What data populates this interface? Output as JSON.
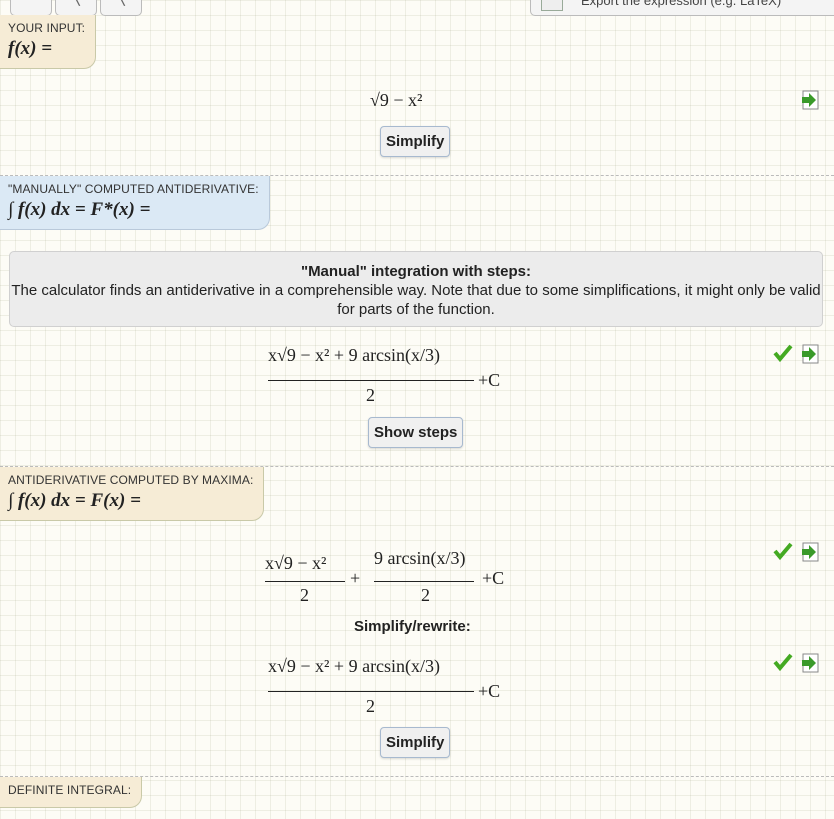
{
  "toolbar": {
    "export_label": "Export the expression (e.g. LaTeX)"
  },
  "input_section": {
    "caption": "YOUR INPUT:",
    "formula": "f(x) =",
    "expression": "√9 − x²",
    "simplify_label": "Simplify"
  },
  "manual_section": {
    "caption": "\"MANUALLY\" COMPUTED ANTIDERIVATIVE:",
    "formula": "∫ f(x) dx = F*(x) =",
    "info_title": "\"Manual\" integration with steps:",
    "info_text": "The calculator finds an antiderivative in a comprehensible way. Note that due to some simplifications, it might only be valid for parts of the function.",
    "result_numerator": "x√9 − x² + 9 arcsin(x/3)",
    "result_denominator": "2",
    "plus_c": "+C",
    "show_steps_label": "Show steps"
  },
  "maxima_section": {
    "caption": "ANTIDERIVATIVE COMPUTED BY MAXIMA:",
    "formula": "∫ f(x) dx = F(x) =",
    "term1_numerator": "x√9 − x²",
    "term1_denominator": "2",
    "plus": "+",
    "term2_numerator": "9 arcsin(x/3)",
    "term2_denominator": "2",
    "plus_c": "+C",
    "rewrite_heading": "Simplify/rewrite:",
    "rewrite_numerator": "x√9 − x² + 9 arcsin(x/3)",
    "rewrite_denominator": "2",
    "rewrite_plus_c": "+C",
    "simplify_label": "Simplify"
  },
  "definite_section": {
    "caption": "DEFINITE INTEGRAL:"
  },
  "colors": {
    "accent_blue": "#dbe9f5",
    "accent_beige": "#f6ecd6",
    "check_green": "#44aa22"
  },
  "icons": [
    "check-icon",
    "export-icon"
  ]
}
